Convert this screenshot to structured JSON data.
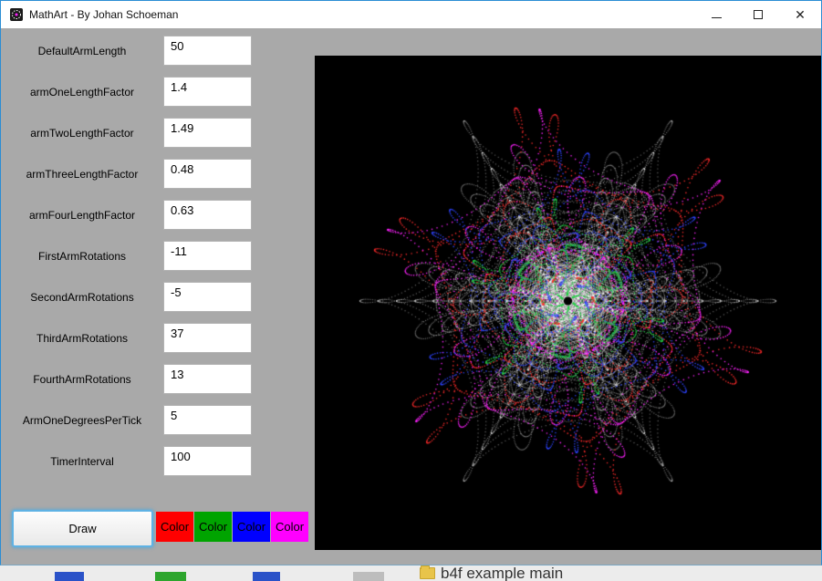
{
  "window": {
    "title": "MathArt - By Johan Schoeman",
    "minimize_glyph": "",
    "maximize_glyph": "",
    "close_glyph": "✕"
  },
  "parameters": [
    {
      "label": "DefaultArmLength",
      "value": "50"
    },
    {
      "label": "armOneLengthFactor",
      "value": "1.4"
    },
    {
      "label": "armTwoLengthFactor",
      "value": "1.49"
    },
    {
      "label": "armThreeLengthFactor",
      "value": "0.48"
    },
    {
      "label": "armFourLengthFactor",
      "value": "0.63"
    },
    {
      "label": "FirstArmRotations",
      "value": "-11"
    },
    {
      "label": "SecondArmRotations",
      "value": "-5"
    },
    {
      "label": "ThirdArmRotations",
      "value": "37"
    },
    {
      "label": "FourthArmRotations",
      "value": "13"
    },
    {
      "label": "ArmOneDegreesPerTick",
      "value": "5"
    },
    {
      "label": "TimerInterval",
      "value": "100"
    }
  ],
  "actions": {
    "draw_label": "Draw",
    "color_buttons": [
      {
        "label": "Color",
        "color": "#ff0000"
      },
      {
        "label": "Color",
        "color": "#00a400"
      },
      {
        "label": "Color",
        "color": "#0000ff"
      },
      {
        "label": "Color",
        "color": "#ff00ff"
      }
    ]
  },
  "art": {
    "background": "#000000",
    "curve_colors": {
      "web": "#ffffff",
      "red": "#ff2a2a",
      "magenta": "#ff22ff",
      "blue": "#2d43ff",
      "green": "#22cc44"
    }
  },
  "background_window": {
    "text": "b4f example main"
  }
}
